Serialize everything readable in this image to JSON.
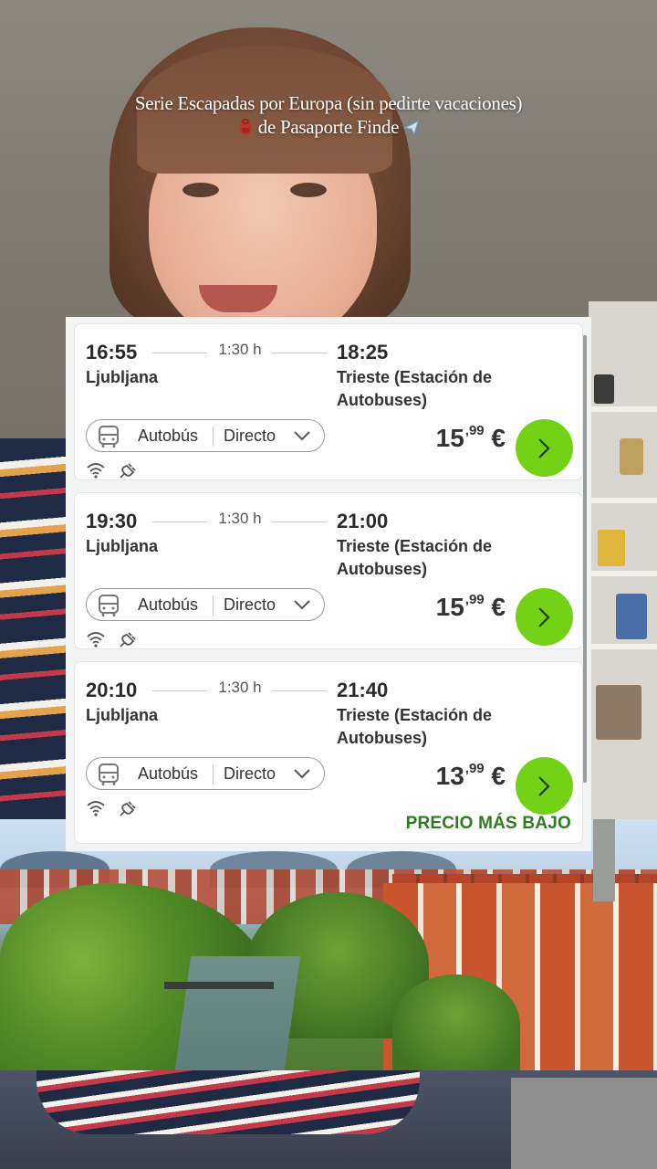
{
  "caption": {
    "line1": "Serie Escapadas por Europa (sin pedirte vacaciones)",
    "line2": "de Pasaporte Finde",
    "icons": [
      "backpack-icon",
      "airplane-icon"
    ]
  },
  "colors": {
    "accent_green": "#73d216",
    "badge_green": "#2c7c1e",
    "card_bg": "#ffffff",
    "panel_bg": "#f2f3f3"
  },
  "trips": [
    {
      "departure_time": "16:55",
      "duration": "1:30 h",
      "arrival_time": "18:25",
      "origin": "Ljubljana",
      "destination": "Trieste (Estación de Autobuses)",
      "transport_type": "Autobús",
      "route_type": "Directo",
      "price_main": "15",
      "price_cents": "99",
      "currency": "€",
      "amenities": [
        "wifi-icon",
        "power-plug-icon"
      ],
      "badge": ""
    },
    {
      "departure_time": "19:30",
      "duration": "1:30 h",
      "arrival_time": "21:00",
      "origin": "Ljubljana",
      "destination": "Trieste (Estación de Autobuses)",
      "transport_type": "Autobús",
      "route_type": "Directo",
      "price_main": "15",
      "price_cents": "99",
      "currency": "€",
      "amenities": [
        "wifi-icon",
        "power-plug-icon"
      ],
      "badge": ""
    },
    {
      "departure_time": "20:10",
      "duration": "1:30 h",
      "arrival_time": "21:40",
      "origin": "Ljubljana",
      "destination": "Trieste (Estación de Autobuses)",
      "transport_type": "Autobús",
      "route_type": "Directo",
      "price_main": "13",
      "price_cents": "99",
      "currency": "€",
      "amenities": [
        "wifi-icon",
        "power-plug-icon"
      ],
      "badge": "PRECIO MÁS BAJO"
    }
  ]
}
